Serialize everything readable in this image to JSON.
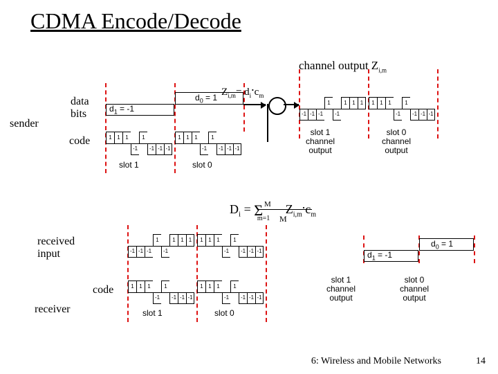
{
  "title": "CDMA Encode/Decode",
  "footer": {
    "section": "6: Wireless and Mobile Networks",
    "page": "14"
  },
  "labels": {
    "sender": "sender",
    "receiver": "receiver",
    "data_bits": "data\nbits",
    "code": "code",
    "received_input": "received\ninput",
    "slot1": "slot 1",
    "slot0": "slot 0",
    "slot1_out": "slot 1\nchannel\noutput",
    "slot0_out": "slot 0\nchannel\noutput",
    "channel_output": "channel output Z",
    "channel_output_sub": "i,m",
    "zim_eq": "Z",
    "zim_rest": "= d",
    "zim_rest2": "c",
    "zim_sub1": "i,m",
    "zim_sub2": "i",
    "zim_sub3": "m",
    "d0": "d",
    "d0_sub": "0",
    "d0_eq": " = 1",
    "d1": "d",
    "d1_sub": "1",
    "d1_eq": " = -1",
    "M": "M",
    "formula": "D",
    "formula_sub": "i",
    "formula_eq": " = ",
    "formula_rhs_z": "Z",
    "formula_rhs_c": "c",
    "m_eq_1": "m=1"
  },
  "chart_data": {
    "type": "table",
    "chip_code": [
      1,
      1,
      1,
      -1,
      1,
      -1,
      -1,
      -1
    ],
    "data_bits": {
      "d1": -1,
      "d0": 1
    },
    "encoded": {
      "slot1": [
        -1,
        -1,
        -1,
        1,
        -1,
        1,
        1,
        1
      ],
      "slot0": [
        1,
        1,
        1,
        -1,
        1,
        -1,
        -1,
        -1
      ]
    },
    "received": {
      "slot1": [
        -1,
        -1,
        -1,
        1,
        -1,
        1,
        1,
        1
      ],
      "slot0": [
        1,
        1,
        1,
        -1,
        1,
        -1,
        -1,
        -1
      ]
    },
    "decoder_code": [
      1,
      1,
      1,
      -1,
      1,
      -1,
      -1,
      -1
    ],
    "decoded": {
      "d1": -1,
      "d0": 1
    }
  }
}
